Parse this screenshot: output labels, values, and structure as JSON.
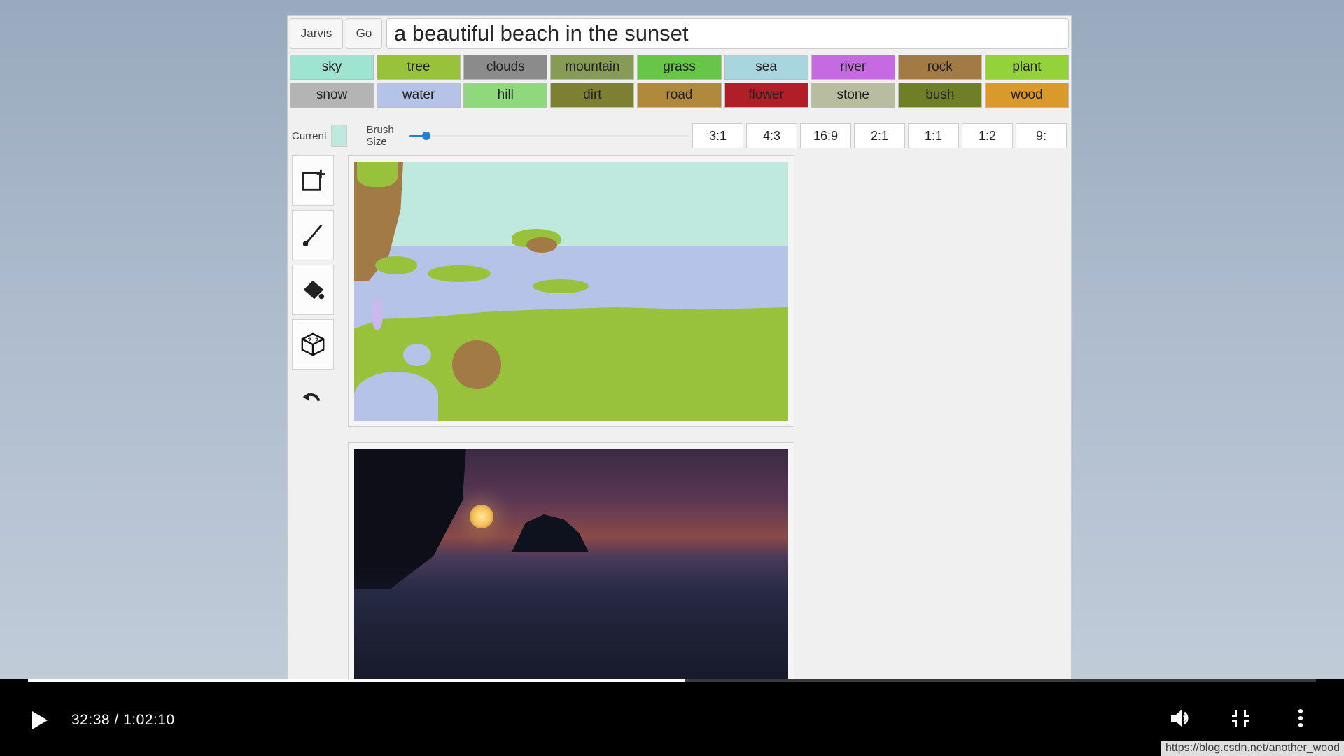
{
  "toolbar": {
    "jarvis_label": "Jarvis",
    "go_label": "Go"
  },
  "prompt": {
    "text": "a beautiful beach in the sunset"
  },
  "categories_row1": [
    {
      "label": "sky",
      "color": "#9fe3d1"
    },
    {
      "label": "tree",
      "color": "#98c23c"
    },
    {
      "label": "clouds",
      "color": "#8b8b8b"
    },
    {
      "label": "mountain",
      "color": "#879a56"
    },
    {
      "label": "grass",
      "color": "#67c647"
    },
    {
      "label": "sea",
      "color": "#a9d5df"
    },
    {
      "label": "river",
      "color": "#c56ae0"
    },
    {
      "label": "rock",
      "color": "#a17a45"
    },
    {
      "label": "plant",
      "color": "#94d23b"
    }
  ],
  "categories_row2": [
    {
      "label": "snow",
      "color": "#b4b4b4"
    },
    {
      "label": "water",
      "color": "#b6c3e9"
    },
    {
      "label": "hill",
      "color": "#8fd97c"
    },
    {
      "label": "dirt",
      "color": "#7d7f32"
    },
    {
      "label": "road",
      "color": "#b0893d"
    },
    {
      "label": "flower",
      "color": "#b01e28"
    },
    {
      "label": "stone",
      "color": "#b7bd9e"
    },
    {
      "label": "bush",
      "color": "#6f7f28"
    },
    {
      "label": "wood",
      "color": "#d99a2b"
    }
  ],
  "brush": {
    "current_label": "Current",
    "current_color": "#bfe9de",
    "size_label": "Brush Size"
  },
  "ratios": [
    "3:1",
    "4:3",
    "16:9",
    "2:1",
    "1:1",
    "1:2",
    "9:"
  ],
  "player": {
    "elapsed": "32:38",
    "sep": " / ",
    "total": "1:02:10",
    "progress_pct": 51
  },
  "footer_url": "https://blog.csdn.net/another_wood"
}
